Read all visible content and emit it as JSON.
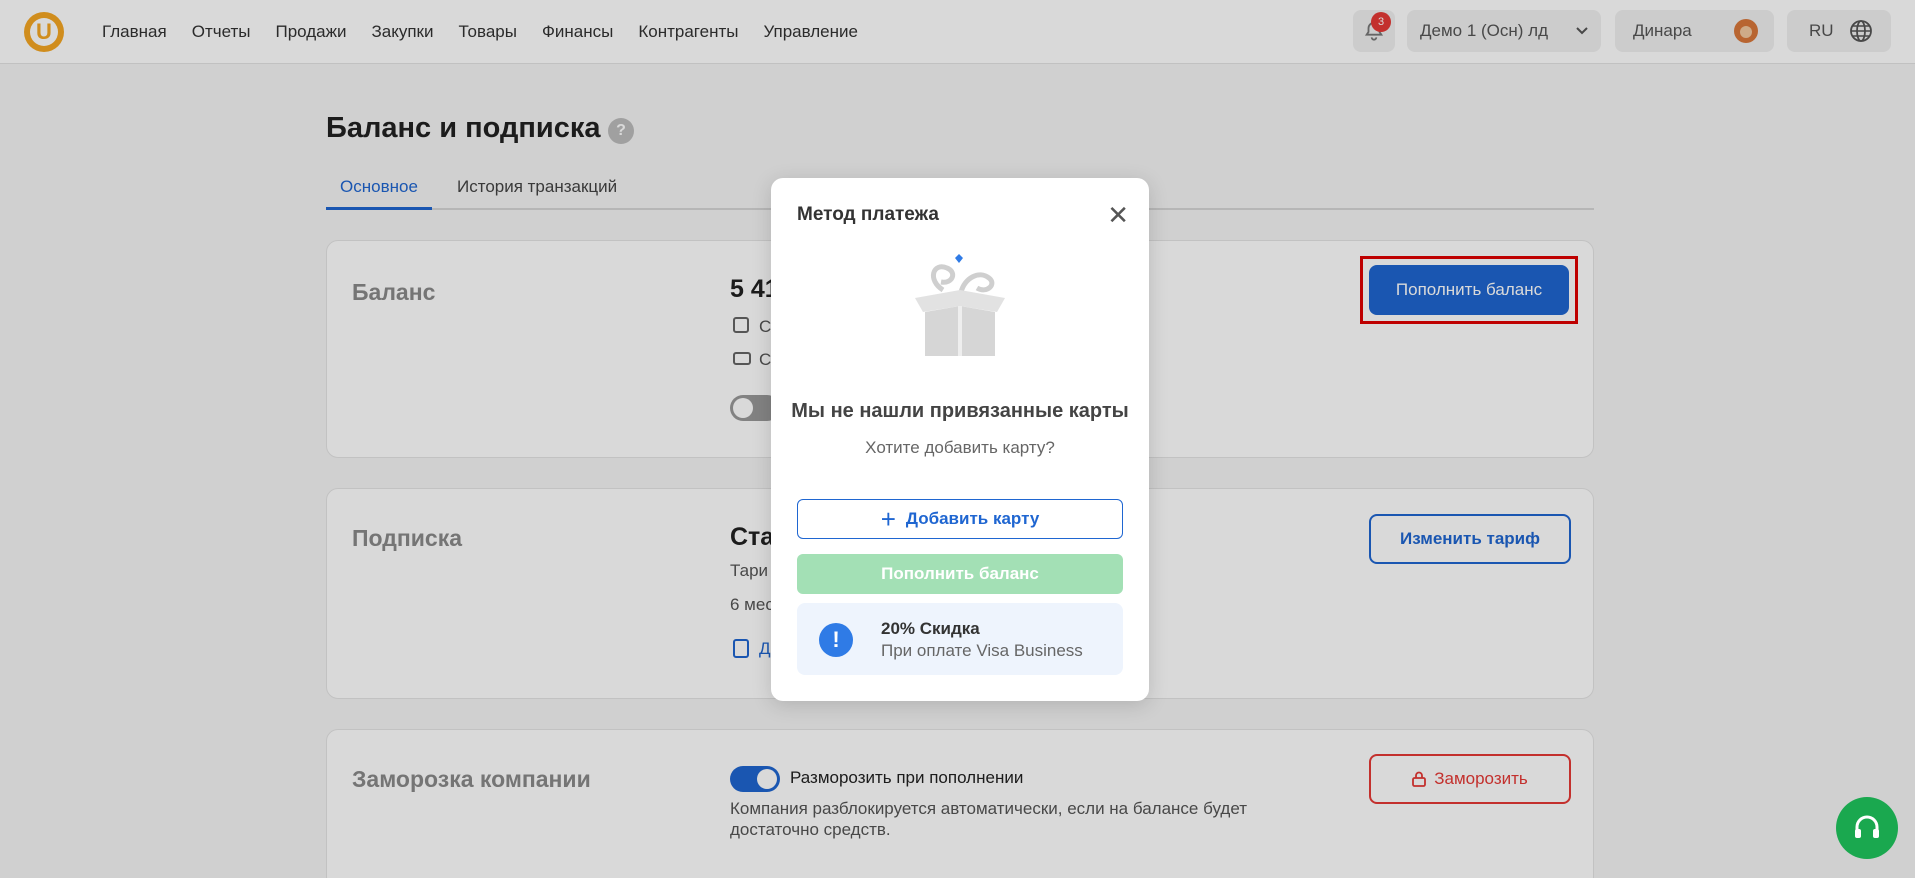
{
  "nav": {
    "logo": "U",
    "items": [
      "Главная",
      "Отчеты",
      "Продажи",
      "Закупки",
      "Товары",
      "Финансы",
      "Контрагенты",
      "Управление"
    ],
    "notifications_count": "3",
    "company": "Демо 1 (Осн) лд",
    "user": "Динара",
    "lang": "RU"
  },
  "page": {
    "title": "Баланс и подписка",
    "help": "?",
    "tabs": [
      "Основное",
      "История транзакций"
    ]
  },
  "balance": {
    "title": "Баланс",
    "value_visible": "5 41",
    "row1": "С",
    "row2": "С",
    "topup_button": "Пополнить баланс"
  },
  "subscription": {
    "title": "Подписка",
    "plan_visible": "Ста",
    "line1": "Тари",
    "line2": "6 мес",
    "doc_link": "Д",
    "change_button": "Изменить тариф"
  },
  "freeze": {
    "title": "Заморозка компании",
    "toggle_label": "Разморозить при пополнении",
    "description_line1": "Компания разблокируется автоматически, если на балансе будет",
    "description_line2": "достаточно средств.",
    "freeze_button": "Заморозить"
  },
  "modal": {
    "title": "Метод платежа",
    "heading": "Мы не нашли привязанные карты",
    "subheading": "Хотите добавить карту?",
    "add_card": "Добавить карту",
    "topup": "Пополнить баланс",
    "promo_title": "20% Скидка",
    "promo_text": "При оплате Visa Business"
  },
  "colors": {
    "accent": "#1f66d1",
    "danger": "#e53935",
    "success_disabled": "#a3e0b5",
    "support": "#1aa84f"
  }
}
